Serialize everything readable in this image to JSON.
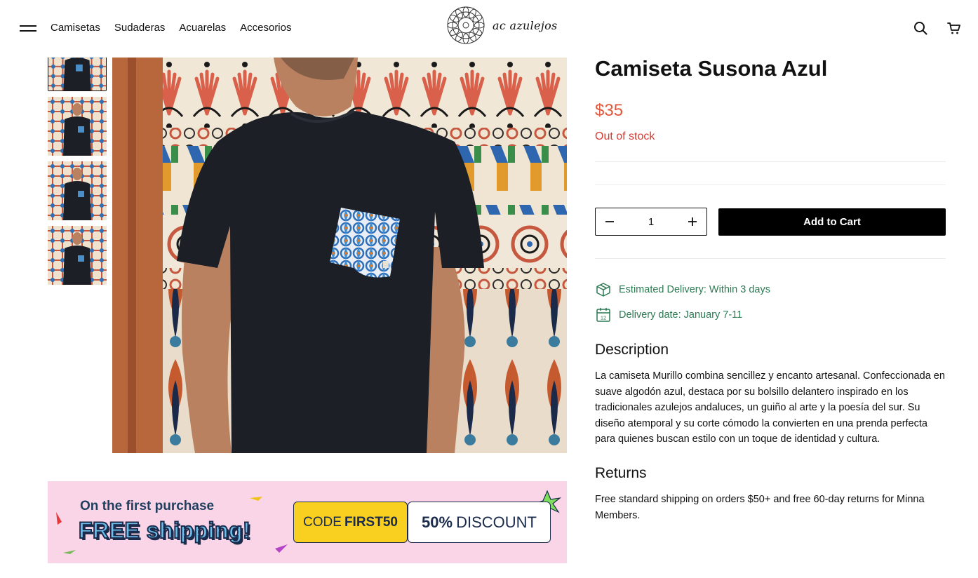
{
  "header": {
    "nav": [
      "Camisetas",
      "Sudaderas",
      "Acuarelas",
      "Accesorios"
    ],
    "logo_text": "ac azulejos"
  },
  "icons": {
    "menu": "hamburger-icon",
    "search": "search-icon",
    "cart": "cart-icon",
    "delivery_box": "package-icon",
    "delivery_calendar": "calendar-icon"
  },
  "gallery": {
    "thumbnail_count": 4,
    "active_thumbnail": 1
  },
  "banner": {
    "line1": "On the first purchase",
    "line2": "FREE shipping!",
    "code_prefix": "CODE",
    "code": "FIRST50",
    "discount_value": "50%",
    "discount_label": "DISCOUNT"
  },
  "product": {
    "title": "Camiseta Susona Azul",
    "price": "$35",
    "stock_status": "Out of stock",
    "quantity": "1",
    "add_to_cart": "Add to Cart",
    "estimated_delivery": "Estimated Delivery: Within 3 days",
    "delivery_date": "Delivery date: January 7-11",
    "calendar_day": "12",
    "description_heading": "Description",
    "description": "La camiseta Murillo combina sencillez y encanto artesanal. Confeccionada en suave algodón azul, destaca por su bolsillo delantero inspirado en los tradicionales azulejos andaluces, un guiño al arte y la poesía del sur. Su diseño atemporal y su corte cómodo la convierten en una prenda perfecta para quienes buscan estilo con un toque de identidad y cultura.",
    "returns_heading": "Returns",
    "returns": "Free standard shipping on orders $50+ and free 60-day returns for Minna Members."
  },
  "colors": {
    "price": "#e3573c",
    "stock": "#d63b2f",
    "delivery": "#2d7a53",
    "banner_bg": "#f9d5e7",
    "coupon_yellow": "#f9d01f",
    "button_bg": "#000000"
  }
}
